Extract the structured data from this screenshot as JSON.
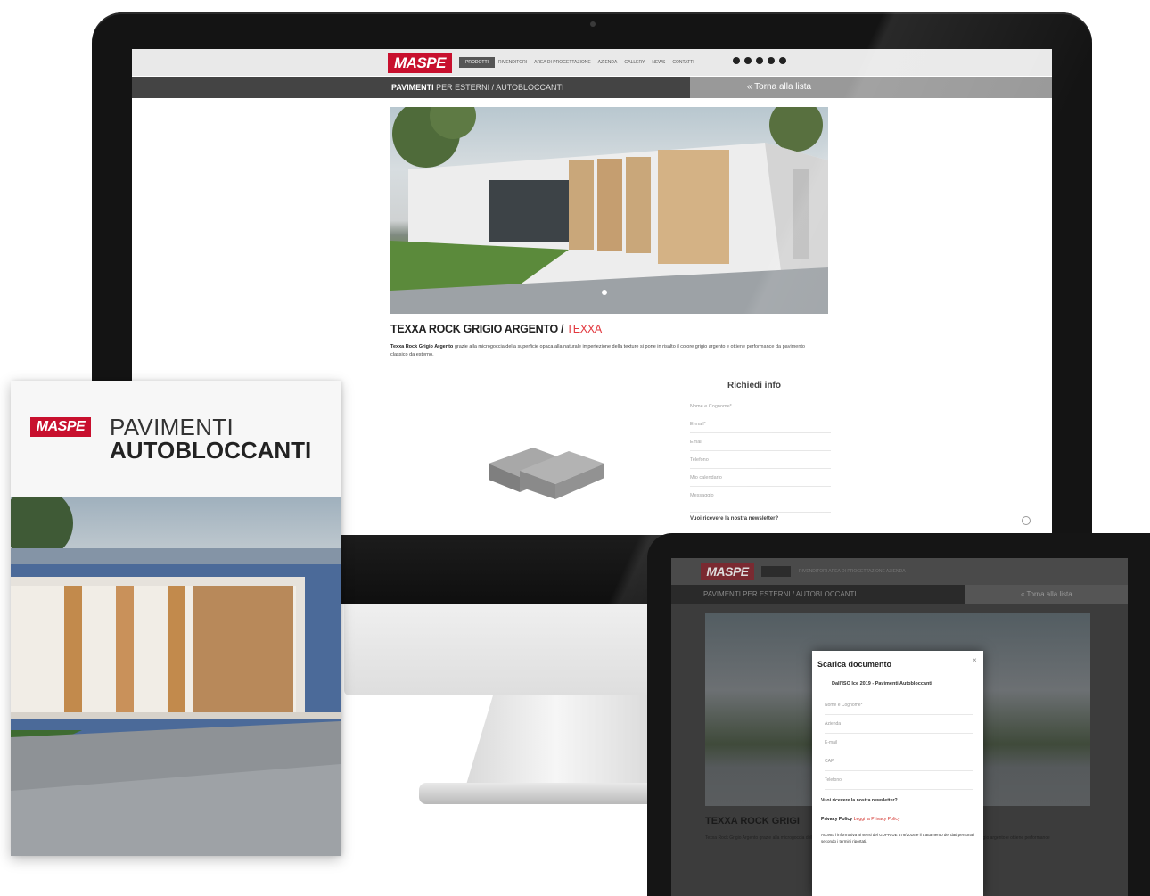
{
  "site": {
    "brand": "MASPE",
    "nav_active": "PRODOTTI",
    "nav_items": [
      "RIVENDITORI",
      "AREA DI PROGETTAZIONE",
      "AZIENDA",
      "GALLERY",
      "NEWS",
      "CONTATTI"
    ],
    "breadcrumb_strong": "PAVIMENTI",
    "breadcrumb_rest": " PER ESTERNI / AUTOBLOCCANTI",
    "back_link": "« Torna alla lista"
  },
  "product": {
    "title": "TEXXA ROCK GRIGIO ARGENTO / ",
    "title_accent": "TEXXA",
    "desc_strong": "Texxa Rock Grigio Argento",
    "desc": " grazie alla microgoccia della superficie opaca alla naturale imperfezione della texture si pone in risalto il colore grigio argento e ottiene performance da pavimento classico da esterno."
  },
  "info_form": {
    "title": "Richiedi info",
    "fields": [
      "Nome e Cognome*",
      "E-mail*",
      "Email",
      "Telefono",
      "Mio calendario",
      "Messaggio"
    ],
    "newsletter": "Vuoi ricevere la nostra newsletter?"
  },
  "brochure": {
    "brand": "MASPE",
    "line1": "PAVIMENTI",
    "line2": "AUTOBLOCCANTI"
  },
  "tablet": {
    "brand": "MASPE",
    "product_title": "TEXXA ROCK GRIGI",
    "product_desc": "Texxa Rock Grigio Argento grazie alla microgoccia della superficie opaca alla naturale imperfezione della texture si pone in risalto il colore grigio argento e ottiene performance",
    "modal": {
      "title": "Scarica documento",
      "close": "×",
      "document": "Dall'ISO Ice 2019 - Pavimenti Autobloccanti",
      "fields": [
        "Nome e Cognome*",
        "Azienda",
        "E-mail",
        "CAP",
        "Telefono"
      ],
      "newsletter": "Vuoi ricevere la nostra newsletter?",
      "privacy_label": "Privacy Policy",
      "privacy_link": "Leggi la Privacy Policy",
      "consent": "Accetto l'informativa ai sensi del GDPR UE 679/2016 e il trattamento dei dati personali secondo i termini riportati."
    }
  },
  "colors": {
    "brand_red": "#c8102e",
    "accent_red": "#e2383f",
    "header_grey": "#e9e9e9",
    "breadcrumb_dark": "#444444"
  }
}
